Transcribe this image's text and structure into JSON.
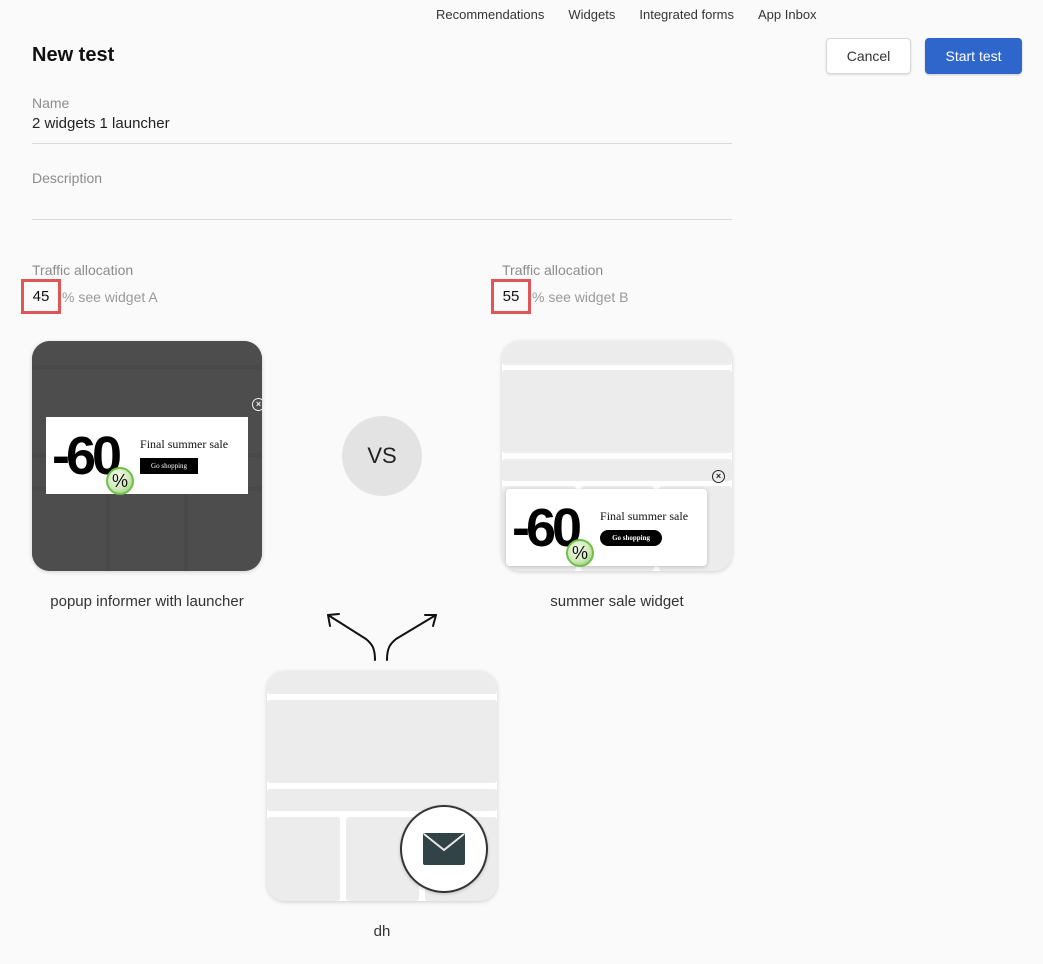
{
  "topnav": {
    "items": [
      {
        "label": "Recommendations"
      },
      {
        "label": "Widgets"
      },
      {
        "label": "Integrated forms"
      },
      {
        "label": "App Inbox"
      }
    ]
  },
  "header": {
    "title": "New test",
    "cancel_label": "Cancel",
    "start_label": "Start test"
  },
  "colors": {
    "primary": "#2f66cc",
    "highlight_box": "#e05555",
    "background": "#fafafa"
  },
  "form": {
    "name": {
      "label": "Name",
      "value": "2 widgets 1 launcher"
    },
    "description": {
      "label": "Description",
      "value": ""
    }
  },
  "traffic": {
    "a": {
      "label": "Traffic allocation",
      "value": "45",
      "suffix": "% see widget A"
    },
    "b": {
      "label": "Traffic allocation",
      "value": "55",
      "suffix": "% see widget B"
    }
  },
  "widgets": {
    "a": {
      "name": "popup informer with launcher",
      "preview": {
        "discount": "-60",
        "percent": "%",
        "title": "Final summer sale",
        "button": "Go shopping",
        "close": "×"
      }
    },
    "b": {
      "name": "summer sale widget",
      "preview": {
        "discount": "-60",
        "percent": "%",
        "title": "Final summer sale",
        "button": "Go shopping",
        "close": "×"
      }
    },
    "launcher": {
      "name": "dh",
      "icon": "envelope-icon"
    }
  },
  "vs_label": "VS"
}
